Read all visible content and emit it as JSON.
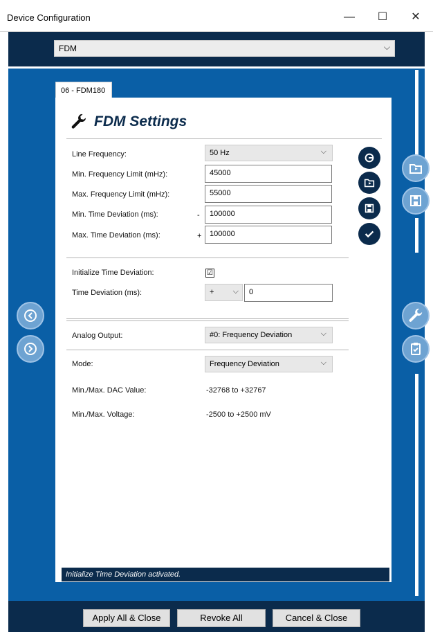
{
  "window": {
    "title": "Device Configuration",
    "minimize": "—",
    "maximize": "☐",
    "close": "✕"
  },
  "device_selector": {
    "value": "FDM",
    "chevron": "⌵"
  },
  "tab": {
    "label": "06 - FDM180"
  },
  "heading": {
    "title": "FDM Settings",
    "icon": "wrench-icon"
  },
  "fields": {
    "line_frequency": {
      "label": "Line Frequency:",
      "value": "50 Hz"
    },
    "min_freq_limit": {
      "label": "Min. Frequency Limit (mHz):",
      "value": "45000"
    },
    "max_freq_limit": {
      "label": "Max. Frequency Limit (mHz):",
      "value": "55000"
    },
    "min_time_dev": {
      "label": "Min. Time Deviation (ms):",
      "sign": "-",
      "value": "100000"
    },
    "max_time_dev": {
      "label": "Max. Time Deviation (ms):",
      "sign": "+",
      "value": "100000"
    },
    "init_time_dev": {
      "label": "Initialize Time Deviation:",
      "checked": "☑"
    },
    "time_dev": {
      "label": "Time Deviation (ms):",
      "sign_value": "+",
      "value": "0"
    },
    "analog_output": {
      "label": "Analog Output:",
      "value": "#0: Frequency Deviation"
    },
    "mode": {
      "label": "Mode:",
      "value": "Frequency Deviation"
    },
    "dac_value": {
      "label": "Min./Max. DAC Value:",
      "value": "-32768 to +32767"
    },
    "voltage": {
      "label": "Min./Max. Voltage:",
      "value": "-2500 to +2500 mV"
    }
  },
  "status": {
    "text": "Initialize Time Deviation activated."
  },
  "footer": {
    "apply": "Apply All & Close",
    "revoke": "Revoke All",
    "cancel": "Cancel & Close"
  },
  "colors": {
    "navy": "#0b2b4c",
    "blue": "#0a5fa6",
    "light_blue": "#6ea3d2"
  }
}
